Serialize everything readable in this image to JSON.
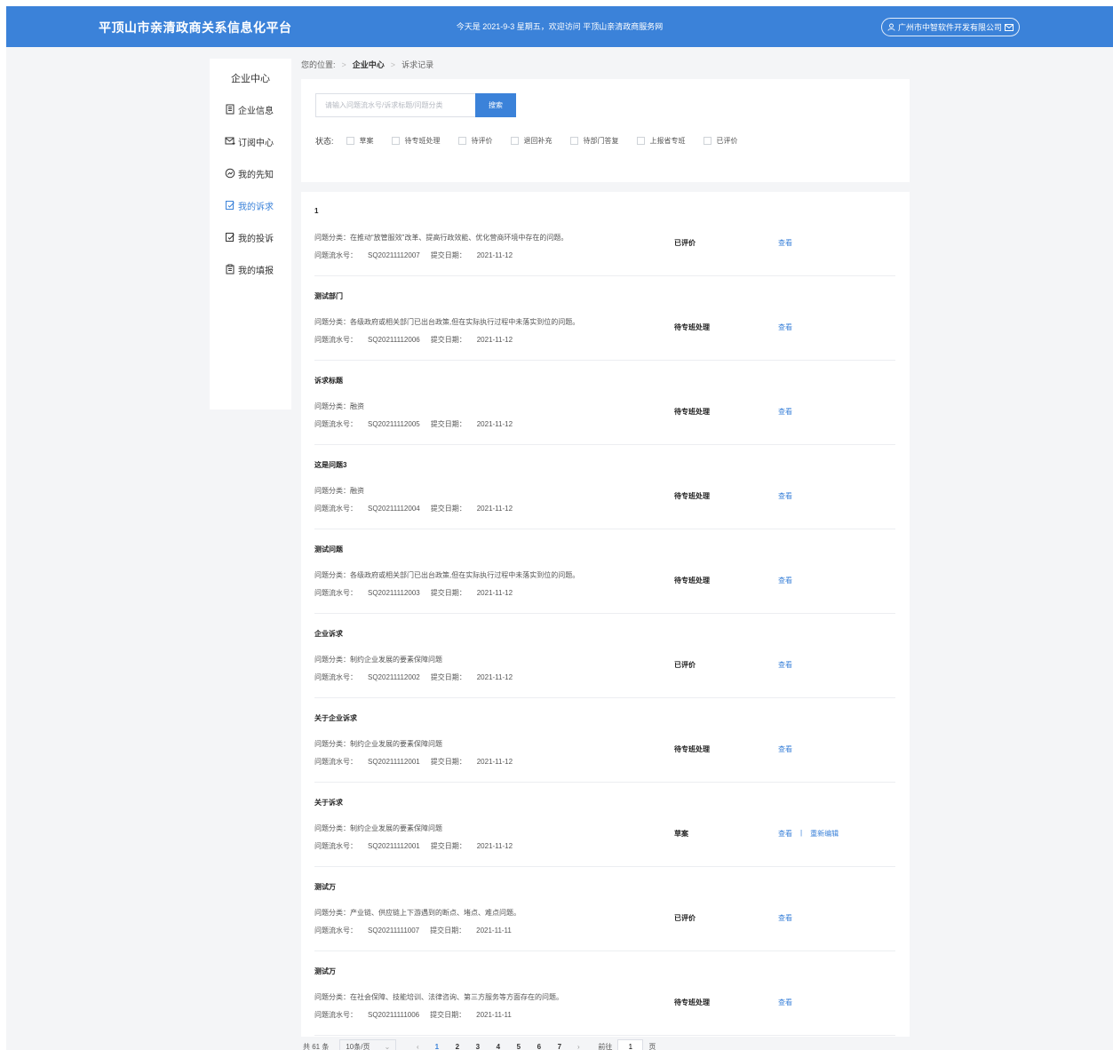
{
  "header": {
    "brand": "平顶山市亲清政商关系信息化平台",
    "welcome": "今天是 2021-9-3 星期五，欢迎访问 平顶山亲清政商服务网",
    "company": "广州市中智软件开发有限公司"
  },
  "sidebar": {
    "title": "企业中心",
    "items": [
      {
        "label": "企业信息",
        "icon": "building-icon",
        "active": false
      },
      {
        "label": "订阅中心",
        "icon": "mail-subscribe-icon",
        "active": false
      },
      {
        "label": "我的先知",
        "icon": "compass-icon",
        "active": false
      },
      {
        "label": "我的诉求",
        "icon": "edit-doc-icon",
        "active": true
      },
      {
        "label": "我的投诉",
        "icon": "edit-doc-icon",
        "active": false
      },
      {
        "label": "我的填报",
        "icon": "clipboard-icon",
        "active": false
      }
    ]
  },
  "breadcrumb": {
    "prefix": "您的位置:",
    "level1": "企业中心",
    "level2": "诉求记录"
  },
  "filter": {
    "search_placeholder": "请输入问题流水号/诉求标题/问题分类",
    "search_button": "搜索",
    "status_label": "状态:",
    "statuses": [
      "草案",
      "待专班处理",
      "待评价",
      "退回补充",
      "待部门答复",
      "上报省专班",
      "已评价"
    ]
  },
  "labels": {
    "cat_prefix": "问题分类：",
    "serial_prefix": "问题流水号：",
    "date_prefix": "提交日期：",
    "view": "查看",
    "reedit": "重新编辑",
    "pipe": "|"
  },
  "records": [
    {
      "title": "1",
      "category": "在推动“放管服效”改革、提高行政效能、优化营商环境中存在的问题。",
      "serial": "SQ20211112007",
      "date": "2021-11-12",
      "status": "已评价",
      "reedit": false
    },
    {
      "title": "测试部门",
      "category": "各级政府或相关部门已出台政策,但在实际执行过程中未落实到位的问题。",
      "serial": "SQ20211112006",
      "date": "2021-11-12",
      "status": "待专班处理",
      "reedit": false
    },
    {
      "title": "诉求标题",
      "category": "融资",
      "serial": "SQ20211112005",
      "date": "2021-11-12",
      "status": "待专班处理",
      "reedit": false
    },
    {
      "title": "这是问题3",
      "category": "融资",
      "serial": "SQ20211112004",
      "date": "2021-11-12",
      "status": "待专班处理",
      "reedit": false
    },
    {
      "title": "测试问题",
      "category": "各级政府或相关部门已出台政策,但在实际执行过程中未落实到位的问题。",
      "serial": "SQ20211112003",
      "date": "2021-11-12",
      "status": "待专班处理",
      "reedit": false
    },
    {
      "title": "企业诉求",
      "category": "制约企业发展的要素保障问题",
      "serial": "SQ20211112002",
      "date": "2021-11-12",
      "status": "已评价",
      "reedit": false
    },
    {
      "title": "关于企业诉求",
      "category": "制约企业发展的要素保障问题",
      "serial": "SQ20211112001",
      "date": "2021-11-12",
      "status": "待专班处理",
      "reedit": false
    },
    {
      "title": "关于诉求",
      "category": "制约企业发展的要素保障问题",
      "serial": "SQ20211112001",
      "date": "2021-11-12",
      "status": "草案",
      "reedit": true
    },
    {
      "title": "测试万",
      "category": "产业链、供应链上下游遇到的断点、堵点、难点问题。",
      "serial": "SQ20211111007",
      "date": "2021-11-11",
      "status": "已评价",
      "reedit": false
    },
    {
      "title": "测试万",
      "category": "在社会保障、技能培训、法律咨询、第三方服务等方面存在的问题。",
      "serial": "SQ20211111006",
      "date": "2021-11-11",
      "status": "待专班处理",
      "reedit": false
    }
  ],
  "pagination": {
    "total": "共 61 条",
    "page_size": "10条/页",
    "pages": [
      "1",
      "2",
      "3",
      "4",
      "5",
      "6",
      "7"
    ],
    "current": "1",
    "goto_label": "前往",
    "goto_value": "1",
    "page_unit": "页"
  },
  "colors": {
    "primary": "#3b82d9",
    "background": "#f4f5f7"
  }
}
